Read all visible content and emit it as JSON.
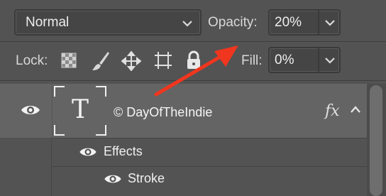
{
  "blend_mode": {
    "value": "Normal"
  },
  "opacity": {
    "label": "Opacity:",
    "value": "20%"
  },
  "lock": {
    "label": "Lock:"
  },
  "fill": {
    "label": "Fill:",
    "value": "0%"
  },
  "layer": {
    "thumbnail_glyph": "T",
    "name": "© DayOfTheIndie",
    "fx": "fx"
  },
  "effects": {
    "label": "Effects"
  },
  "stroke": {
    "label": "Stroke"
  },
  "colors": {
    "panel_bg": "#535353",
    "selected_row_bg": "#646464",
    "annotation_arrow": "#f0361e"
  },
  "icons": [
    "chevron-down-icon",
    "checkerboard-lock-icon",
    "brush-lock-icon",
    "move-lock-icon",
    "artboard-lock-icon",
    "padlock-icon",
    "eye-icon",
    "caret-up-icon"
  ]
}
